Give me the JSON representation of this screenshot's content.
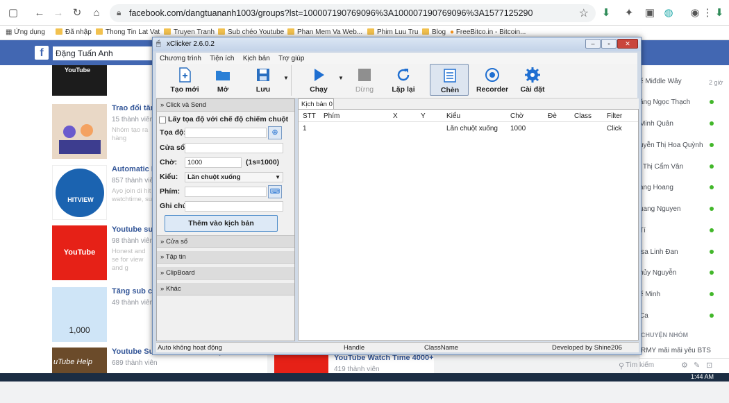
{
  "browser": {
    "url": "facebook.com/dangtuananh1003/groups?lst=100007190769096%3A100007190769096%3A1577125290",
    "bookmarks": [
      "Ứng dụng",
      "Đã nhập",
      "Thong Tin Lat Vat",
      "Truyen Tranh",
      "Sub chéo Youtube",
      "Phan Mem Va Web...",
      "Phim Luu Tru",
      "Blog",
      "FreeBitco.in - Bitcoin..."
    ]
  },
  "facebook": {
    "profile_name": "Đặng Tuấn Anh",
    "groups": [
      {
        "name": "Trao đổi tăng",
        "members": "15 thành viên",
        "desc": "Nhóm tạo ra hàng"
      },
      {
        "name": "Automatic In",
        "members": "857 thành viên",
        "desc": "Ayo join di hit watchtime, su"
      },
      {
        "name": "Youtube subs",
        "members": "98 thành viên",
        "desc": "Honest and se for view and g"
      },
      {
        "name": "Tăng sub chéo",
        "members": "49 thành viên",
        "desc": ""
      },
      {
        "name": "Youtube Subscribers And Help Line BD",
        "members": "689 thành viên",
        "desc": ""
      }
    ],
    "thumb_labels": {
      "youtube": "YouTube",
      "hitview": "HITVIEW",
      "count": "1,000",
      "help": "uTube Help"
    },
    "mid_group": {
      "name": "YouTube Watch Time 4000+",
      "members": "419 thành viên"
    },
    "contacts": [
      "ế Miđdle Wây",
      "ăng Ngọc Thạch",
      "Minh Quân",
      "uyễn Thị Hoa Quỳnh",
      "i Thị Cẩm Vân",
      "ang Hoang",
      "uang Nguyen",
      "Tí",
      "isa Linh Đan",
      "hủy Nguyễn",
      "ế Minh",
      "Ca"
    ],
    "contact_time": "2 giờ",
    "section_label": "CHUYỆN NHÓM",
    "group_chat": "RMY mãi mãi yêu BTS",
    "search_placeholder": "Tìm kiếm",
    "clock": "1:44 AM"
  },
  "xclicker": {
    "title": "xClicker 2.6.0.2",
    "menu": [
      "Chương trình",
      "Tiện ích",
      "Kịch bản",
      "Trợ giúp"
    ],
    "toolbar": {
      "new": "Tạo mới",
      "open": "Mở",
      "save": "Lưu",
      "run": "Chạy",
      "stop": "Dừng",
      "repeat": "Lặp lại",
      "insert": "Chèn",
      "recorder": "Recorder",
      "settings": "Cài đặt"
    },
    "panel": {
      "section_click_send": "Click và Send",
      "checkbox_label": "Lấy tọa độ với chế độ chiếm chuột",
      "coords_label": "Tọa độ:",
      "window_label": "Cửa sổ:",
      "wait_label": "Chờ:",
      "wait_value": "1000",
      "wait_hint": "(1s=1000)",
      "type_label": "Kiểu:",
      "type_value": "Lăn chuột xuống",
      "key_label": "Phím:",
      "note_label": "Ghi chú:",
      "add_button": "Thêm vào kịch bản",
      "sections": [
        "Cửa sổ",
        "Tập tin",
        "ClipBoard",
        "Khác"
      ]
    },
    "script_tab": "Kịch bản 0 *",
    "columns": [
      "STT",
      "Phím",
      "X",
      "Y",
      "Kiểu",
      "Chờ",
      "Đè",
      "Class",
      "Filter"
    ],
    "rows": [
      {
        "stt": "1",
        "phim": "",
        "x": "",
        "y": "",
        "kieu": "Lăn chuột xuống",
        "cho": "1000",
        "de": "",
        "class": "",
        "filter": "Click"
      }
    ],
    "status": {
      "mode": "Auto không hoạt động",
      "handle": "Handle",
      "classname": "ClassName",
      "developer": "Developed by Shine206"
    }
  }
}
